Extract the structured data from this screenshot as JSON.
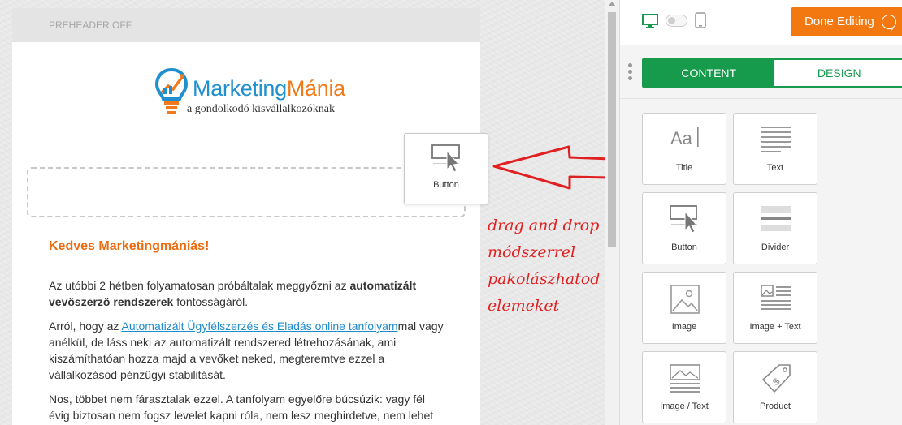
{
  "email": {
    "preheader": "PREHEADER OFF",
    "logo_title_part1": "Marketing",
    "logo_title_part2": "Mánia",
    "logo_subtitle": "a gondolkodó kisvállalkozóknak",
    "greeting": "Kedves Marketingmániás!",
    "p1_a": "Az utóbbi 2 hétben folyamatosan próbáltalak meggyőzni az ",
    "p1_b": "automatizált vevőszerző rendszerek",
    "p1_c": " fontosságáról.",
    "p2_a": "Arról, hogy az ",
    "p2_link": "Automatizált Ügyfélszerzés és Eladás online tanfolyam",
    "p2_b": "mal vagy anélkül, de láss neki az automatizált rendszered létrehozásának, ami kiszámíthatóan hozza majd a vevőket neked, megteremtve ezzel a vállalkozásod pénzügyi stabilitását.",
    "p3": "Nos, többet nem fárasztalak ezzel. A tanfolyam egyelőre búcsúzik: vagy fél évig biztosan nem fogsz levelet kapni róla, nem lesz meghirdetve, nem lehet"
  },
  "dragging_tile": {
    "label": "Button",
    "icon": "button-cursor-icon"
  },
  "annotation": {
    "line1": "drag and drop",
    "line2": "módszerrel",
    "line3": "pakolászhatod az",
    "line4": "elemeket",
    "color": "#e02020"
  },
  "panel": {
    "done_button": "Done Editing",
    "tabs": [
      {
        "label": "CONTENT",
        "active": true
      },
      {
        "label": "DESIGN",
        "active": false
      }
    ],
    "blocks": [
      {
        "label": "Title",
        "icon": "title-icon"
      },
      {
        "label": "Text",
        "icon": "text-lines-icon"
      },
      {
        "label": "Button",
        "icon": "button-cursor-icon"
      },
      {
        "label": "Divider",
        "icon": "divider-icon"
      },
      {
        "label": "Image",
        "icon": "image-icon"
      },
      {
        "label": "Image + Text",
        "icon": "image-text-icon"
      },
      {
        "label": "Image / Text",
        "icon": "image-over-text-icon"
      },
      {
        "label": "Product",
        "icon": "price-tag-icon"
      }
    ]
  },
  "colors": {
    "accent_green": "#169a4c",
    "done_orange": "#f3780f",
    "greeting_orange": "#f06a0f",
    "link_blue": "#1e8ccc"
  }
}
